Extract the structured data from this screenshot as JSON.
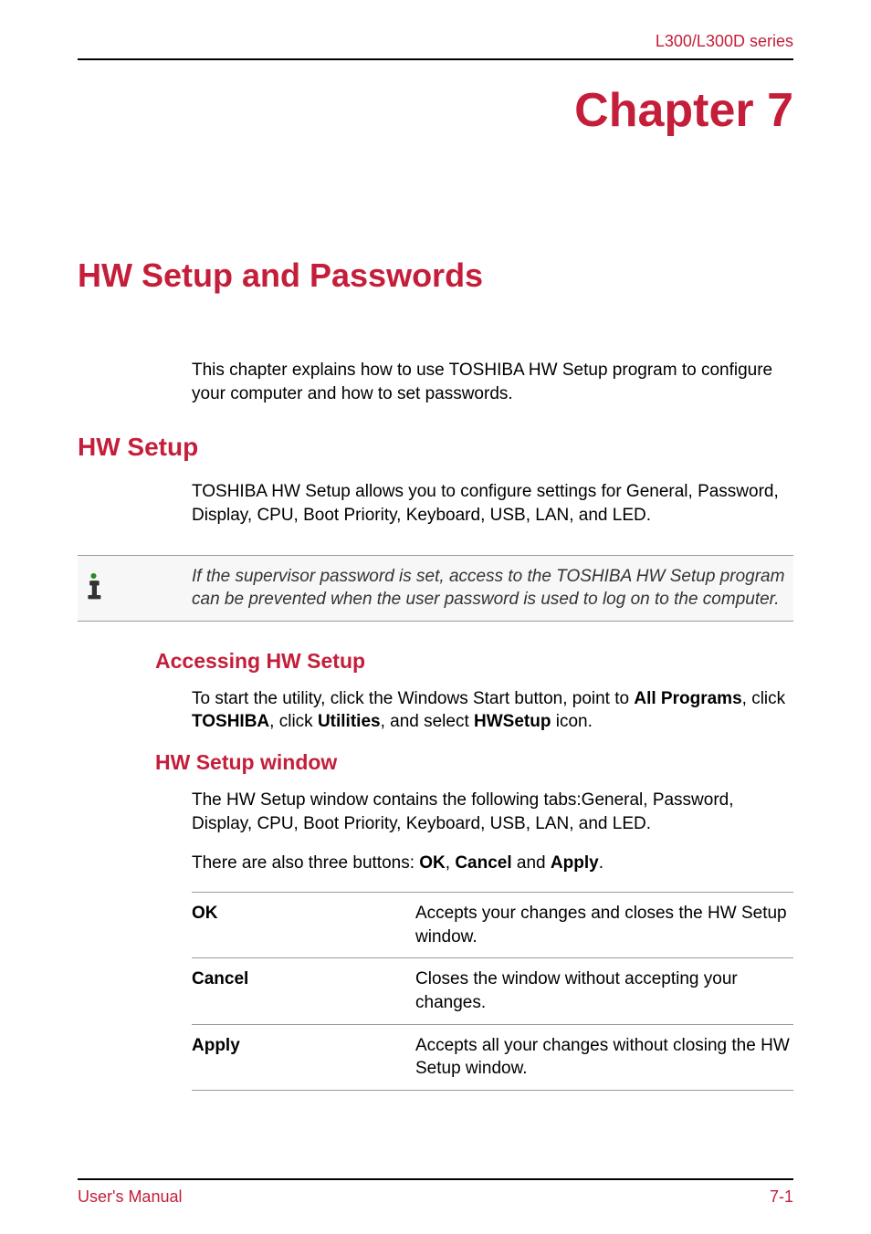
{
  "header": {
    "series": "L300/L300D series"
  },
  "chapter": {
    "title": "Chapter 7"
  },
  "main_title": "HW Setup and Passwords",
  "intro_text": "This chapter explains how to use TOSHIBA HW Setup program to configure your computer and how to set passwords.",
  "section": {
    "title": "HW Setup",
    "text": "TOSHIBA HW Setup allows you to configure settings for General, Password, Display, CPU, Boot Priority, Keyboard, USB, LAN, and LED."
  },
  "note": {
    "text": "If the supervisor password is set, access to the TOSHIBA HW Setup program can be prevented when the user password is used to log on to the computer."
  },
  "subsection1": {
    "title": "Accessing HW Setup",
    "text_pre": "To start the utility, click the Windows Start button, point to ",
    "bold1": "All Programs",
    "text_mid1": ", click ",
    "bold2": "TOSHIBA",
    "text_mid2": ", click ",
    "bold3": "Utilities",
    "text_mid3": ", and select ",
    "bold4": "HWSetup",
    "text_post": " icon."
  },
  "subsection2": {
    "title": "HW Setup window",
    "text1": "The HW Setup window contains the following tabs:General, Password, Display, CPU, Boot Priority, Keyboard, USB, LAN, and LED.",
    "text2_pre": "There are also three buttons: ",
    "text2_b1": "OK",
    "text2_m1": ", ",
    "text2_b2": "Cancel",
    "text2_m2": " and ",
    "text2_b3": "Apply",
    "text2_post": "."
  },
  "buttons": [
    {
      "label": "OK",
      "desc": "Accepts your changes and closes the HW Setup window."
    },
    {
      "label": "Cancel",
      "desc": "Closes the window without accepting your changes."
    },
    {
      "label": "Apply",
      "desc": "Accepts all your changes without closing the HW Setup window."
    }
  ],
  "footer": {
    "left": "User's Manual",
    "right": "7-1"
  }
}
